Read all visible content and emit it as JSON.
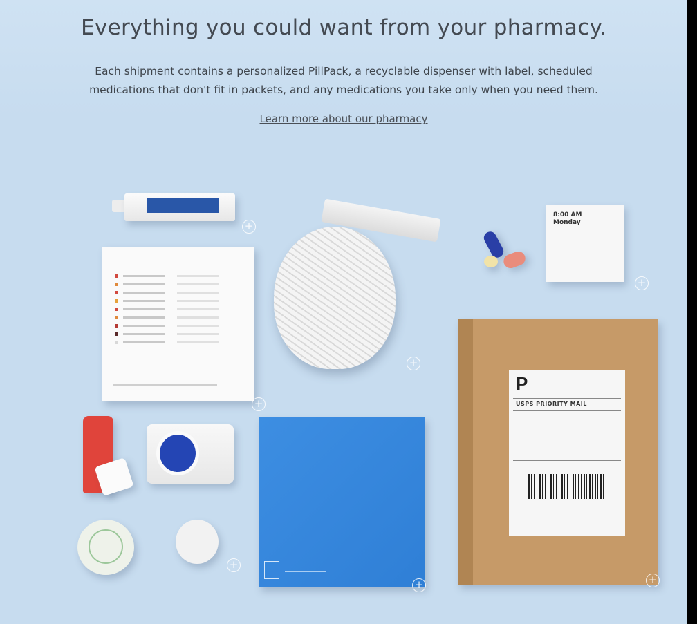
{
  "hero": {
    "title": "Everything you could want from your pharmacy.",
    "description_line1": "Each shipment contains a personalized PillPack, a recyclable dispenser with label, scheduled",
    "description_line2": "medications that don't fit in packets, and any medications you take only when you need them.",
    "link_label": "Learn more about our pharmacy"
  },
  "product_art": {
    "pouch_time": "8:00 AM",
    "pouch_day": "Monday",
    "mail_label_letter": "P",
    "mail_label_service": "USPS PRIORITY MAIL"
  },
  "colors": {
    "background": "#c7dcef",
    "text": "#444a52",
    "pillpack_box": "#3d8ee2",
    "cardboard": "#c69a68"
  }
}
